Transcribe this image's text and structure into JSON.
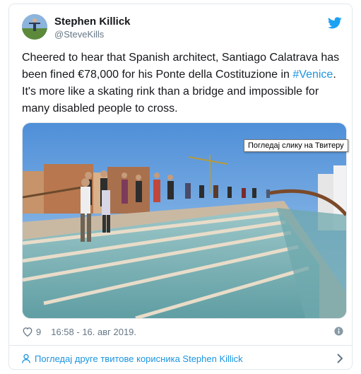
{
  "author": {
    "display_name": "Stephen Killick",
    "handle": "@SteveKills"
  },
  "tweet": {
    "text_part1": "Cheered to hear that Spanish architect, Santiago Calatrava has been fined €78,000 for his Ponte della Costituzione in ",
    "hashtag": "#Venice",
    "text_part2": ". It's more like a skating rink than a bridge and impossible for many disabled people to cross."
  },
  "media": {
    "tooltip": "Погледај слику на Твитеру"
  },
  "meta": {
    "likes": "9",
    "timestamp": "16:58 - 16. авг 2019."
  },
  "footer": {
    "link_text": "Погледај друге твитове корисника Stephen Killick"
  },
  "colors": {
    "link": "#1b95e0",
    "text": "#14171a",
    "muted": "#657786",
    "border": "#e1e8ed"
  },
  "icons": [
    "twitter-bird-icon",
    "heart-icon",
    "info-icon",
    "person-icon",
    "chevron-right-icon"
  ]
}
